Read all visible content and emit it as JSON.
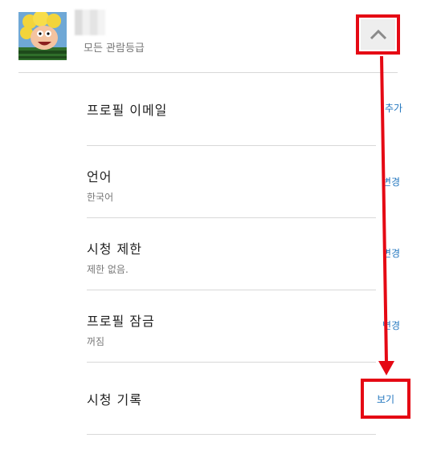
{
  "profile": {
    "rating": "모든 관람등급",
    "avatar_icon": "cartoon-character-avatar"
  },
  "collapse_icon": "chevron-up-icon",
  "rows": [
    {
      "title": "프로필 이메일",
      "subtitle": "",
      "action": "추가"
    },
    {
      "title": "언어",
      "subtitle": "한국어",
      "action": "변경"
    },
    {
      "title": "시청 제한",
      "subtitle": "제한 없음.",
      "action": "변경"
    },
    {
      "title": "프로필 잠금",
      "subtitle": "꺼짐",
      "action": "변경"
    },
    {
      "title": "시청 기록",
      "subtitle": "",
      "action": "보기"
    }
  ],
  "colors": {
    "highlight": "#e50914",
    "link": "#2276bf",
    "divider": "#d8d8d8"
  }
}
